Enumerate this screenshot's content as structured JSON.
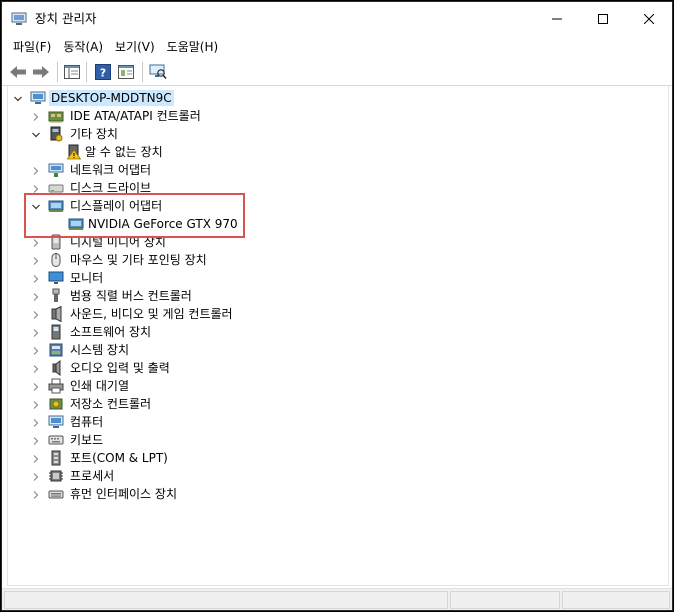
{
  "window": {
    "title": "장치 관리자"
  },
  "menu": {
    "file": "파일(F)",
    "action": "동작(A)",
    "view": "보기(V)",
    "help": "도움말(H)"
  },
  "toolbar": {
    "icons": [
      "back-arrow-icon",
      "forward-arrow-icon",
      "show-hide-console-tree-icon",
      "help-icon",
      "properties-icon",
      "scan-hardware-icon"
    ]
  },
  "tree": {
    "root": "DESKTOP-MDDTN9C",
    "items": [
      {
        "label": "IDE ATA/ATAPI 컨트롤러",
        "icon": "ide-controller-icon",
        "expanded": false
      },
      {
        "label": "기타 장치",
        "icon": "other-devices-icon",
        "expanded": true
      },
      {
        "label": "알 수 없는 장치",
        "icon": "unknown-device-warning-icon",
        "child": true
      },
      {
        "label": "네트워크 어댑터",
        "icon": "network-adapter-icon",
        "expanded": false
      },
      {
        "label": "디스크 드라이브",
        "icon": "disk-drive-icon",
        "expanded": false
      },
      {
        "label": "디스플레이 어댑터",
        "icon": "display-adapter-icon",
        "expanded": true
      },
      {
        "label": "NVIDIA GeForce GTX 970",
        "icon": "display-adapter-icon",
        "child": true
      },
      {
        "label": "디지털 미디어 장치",
        "icon": "digital-media-icon",
        "expanded": false
      },
      {
        "label": "마우스 및 기타 포인팅 장치",
        "icon": "mouse-icon",
        "expanded": false
      },
      {
        "label": "모니터",
        "icon": "monitor-icon",
        "expanded": false
      },
      {
        "label": "범용 직렬 버스 컨트롤러",
        "icon": "usb-icon",
        "expanded": false
      },
      {
        "label": "사운드, 비디오 및 게임 컨트롤러",
        "icon": "speaker-icon",
        "expanded": false
      },
      {
        "label": "소프트웨어 장치",
        "icon": "software-device-icon",
        "expanded": false
      },
      {
        "label": "시스템 장치",
        "icon": "system-device-icon",
        "expanded": false
      },
      {
        "label": "오디오 입력 및 출력",
        "icon": "audio-icon",
        "expanded": false
      },
      {
        "label": "인쇄 대기열",
        "icon": "printer-icon",
        "expanded": false
      },
      {
        "label": "저장소 컨트롤러",
        "icon": "storage-controller-icon",
        "expanded": false
      },
      {
        "label": "컴퓨터",
        "icon": "computer-icon",
        "expanded": false
      },
      {
        "label": "키보드",
        "icon": "keyboard-icon",
        "expanded": false
      },
      {
        "label": "포트(COM & LPT)",
        "icon": "port-icon",
        "expanded": false
      },
      {
        "label": "프로세서",
        "icon": "processor-icon",
        "expanded": false
      },
      {
        "label": "휴먼 인터페이스 장치",
        "icon": "hid-icon",
        "expanded": false
      }
    ]
  },
  "highlight": {
    "color": "#d9534f",
    "target": "디스플레이 어댑터"
  }
}
